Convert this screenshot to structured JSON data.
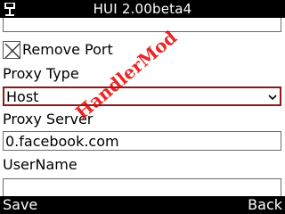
{
  "window": {
    "title": "HUI 2.00beta4"
  },
  "fields": {
    "remove_port": {
      "label": "Remove Port",
      "checked": true
    },
    "proxy_type": {
      "label": "Proxy Type",
      "value": "Host"
    },
    "proxy_server": {
      "label": "Proxy Server",
      "value": "0.facebook.com"
    },
    "username": {
      "label": "UserName",
      "value": ""
    }
  },
  "softkeys": {
    "left": "Save",
    "right": "Back"
  },
  "watermark": {
    "text": "HandlerMod"
  },
  "colors": {
    "bar": "#000000",
    "select_border": "#8b1a1a",
    "watermark": "#e60000"
  }
}
